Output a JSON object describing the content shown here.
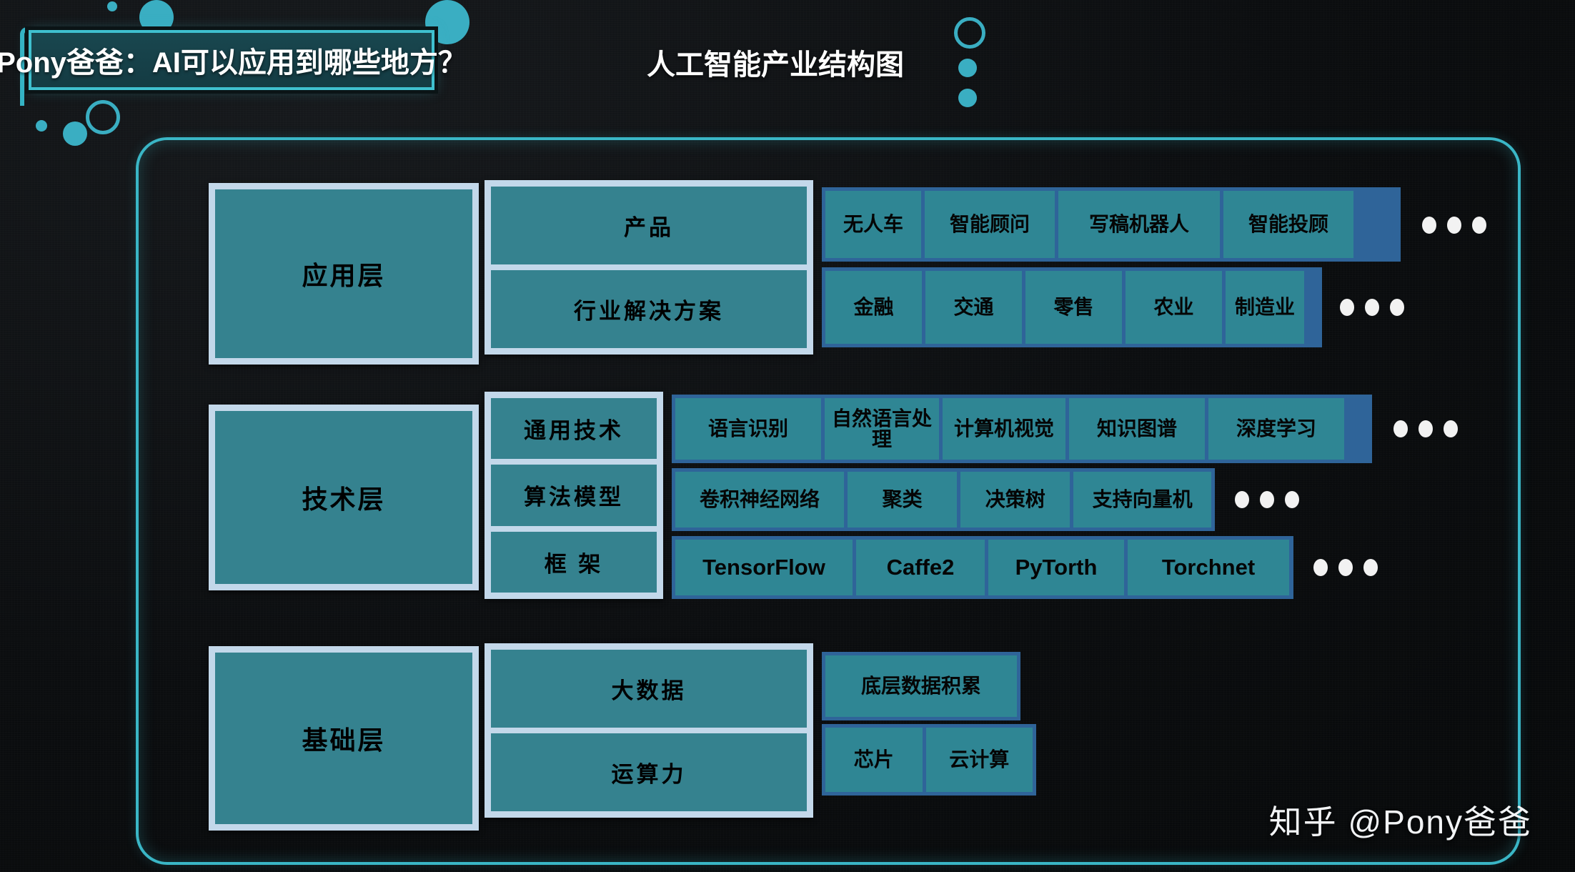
{
  "header": {
    "title": "Pony爸爸：AI可以应用到哪些地方？",
    "subtitle": "人工智能产业结构图"
  },
  "watermark": "知乎 @Pony爸爸",
  "ellipsis_glyph": "•••",
  "colors": {
    "background": "#0a0c0e",
    "accent_cyan": "#3ab6c6",
    "box_teal": "#35828f",
    "box_border_light": "#c3d8ea",
    "pill_border_blue": "#2f6499",
    "pill_fill": "#2f8694",
    "title_panel": "#19474f",
    "text_dark": "#000000",
    "text_light": "#ffffff"
  },
  "chart_data": {
    "type": "diagram",
    "title": "人工智能产业结构图",
    "layers": [
      {
        "name": "应用层",
        "categories": [
          {
            "name": "产品",
            "items": [
              "无人车",
              "智能顾问",
              "写稿机器人",
              "智能投顾"
            ],
            "more": true
          },
          {
            "name": "行业解决方案",
            "items": [
              "金融",
              "交通",
              "零售",
              "农业",
              "制造业"
            ],
            "more": true
          }
        ]
      },
      {
        "name": "技术层",
        "categories": [
          {
            "name": "通用技术",
            "items": [
              "语言识别",
              "自然语言处理",
              "计算机视觉",
              "知识图谱",
              "深度学习"
            ],
            "more": true
          },
          {
            "name": "算法模型",
            "items": [
              "卷积神经网络",
              "聚类",
              "决策树",
              "支持向量机"
            ],
            "more": true
          },
          {
            "name": "框 架",
            "items": [
              "TensorFlow",
              "Caffe2",
              "PyTorth",
              "Torchnet"
            ],
            "more": true
          }
        ]
      },
      {
        "name": "基础层",
        "categories": [
          {
            "name": "大数据",
            "items": [
              "底层数据积累"
            ],
            "more": false
          },
          {
            "name": "运算力",
            "items": [
              "芯片",
              "云计算"
            ],
            "more": false
          }
        ]
      }
    ]
  },
  "layers": {
    "application": {
      "title": "应用层",
      "group": {
        "row1": "产品",
        "row2": "行业解决方案"
      },
      "products": [
        "无人车",
        "智能顾问",
        "写稿机器人",
        "智能投顾"
      ],
      "industries": [
        "金融",
        "交通",
        "零售",
        "农业",
        "制造业"
      ]
    },
    "technology": {
      "title": "技术层",
      "group": {
        "row1": "通用技术",
        "row2": "算法模型",
        "row3": "框 架"
      },
      "general": [
        "语言识别",
        "自然语言处理",
        "计算机视觉",
        "知识图谱",
        "深度学习"
      ],
      "algorithms": [
        "卷积神经网络",
        "聚类",
        "决策树",
        "支持向量机"
      ],
      "frameworks": [
        "TensorFlow",
        "Caffe2",
        "PyTorth",
        "Torchnet"
      ]
    },
    "foundation": {
      "title": "基础层",
      "group": {
        "row1": "大数据",
        "row2": "运算力"
      },
      "bigdata": [
        "底层数据积累"
      ],
      "compute": [
        "芯片",
        "云计算"
      ]
    }
  }
}
